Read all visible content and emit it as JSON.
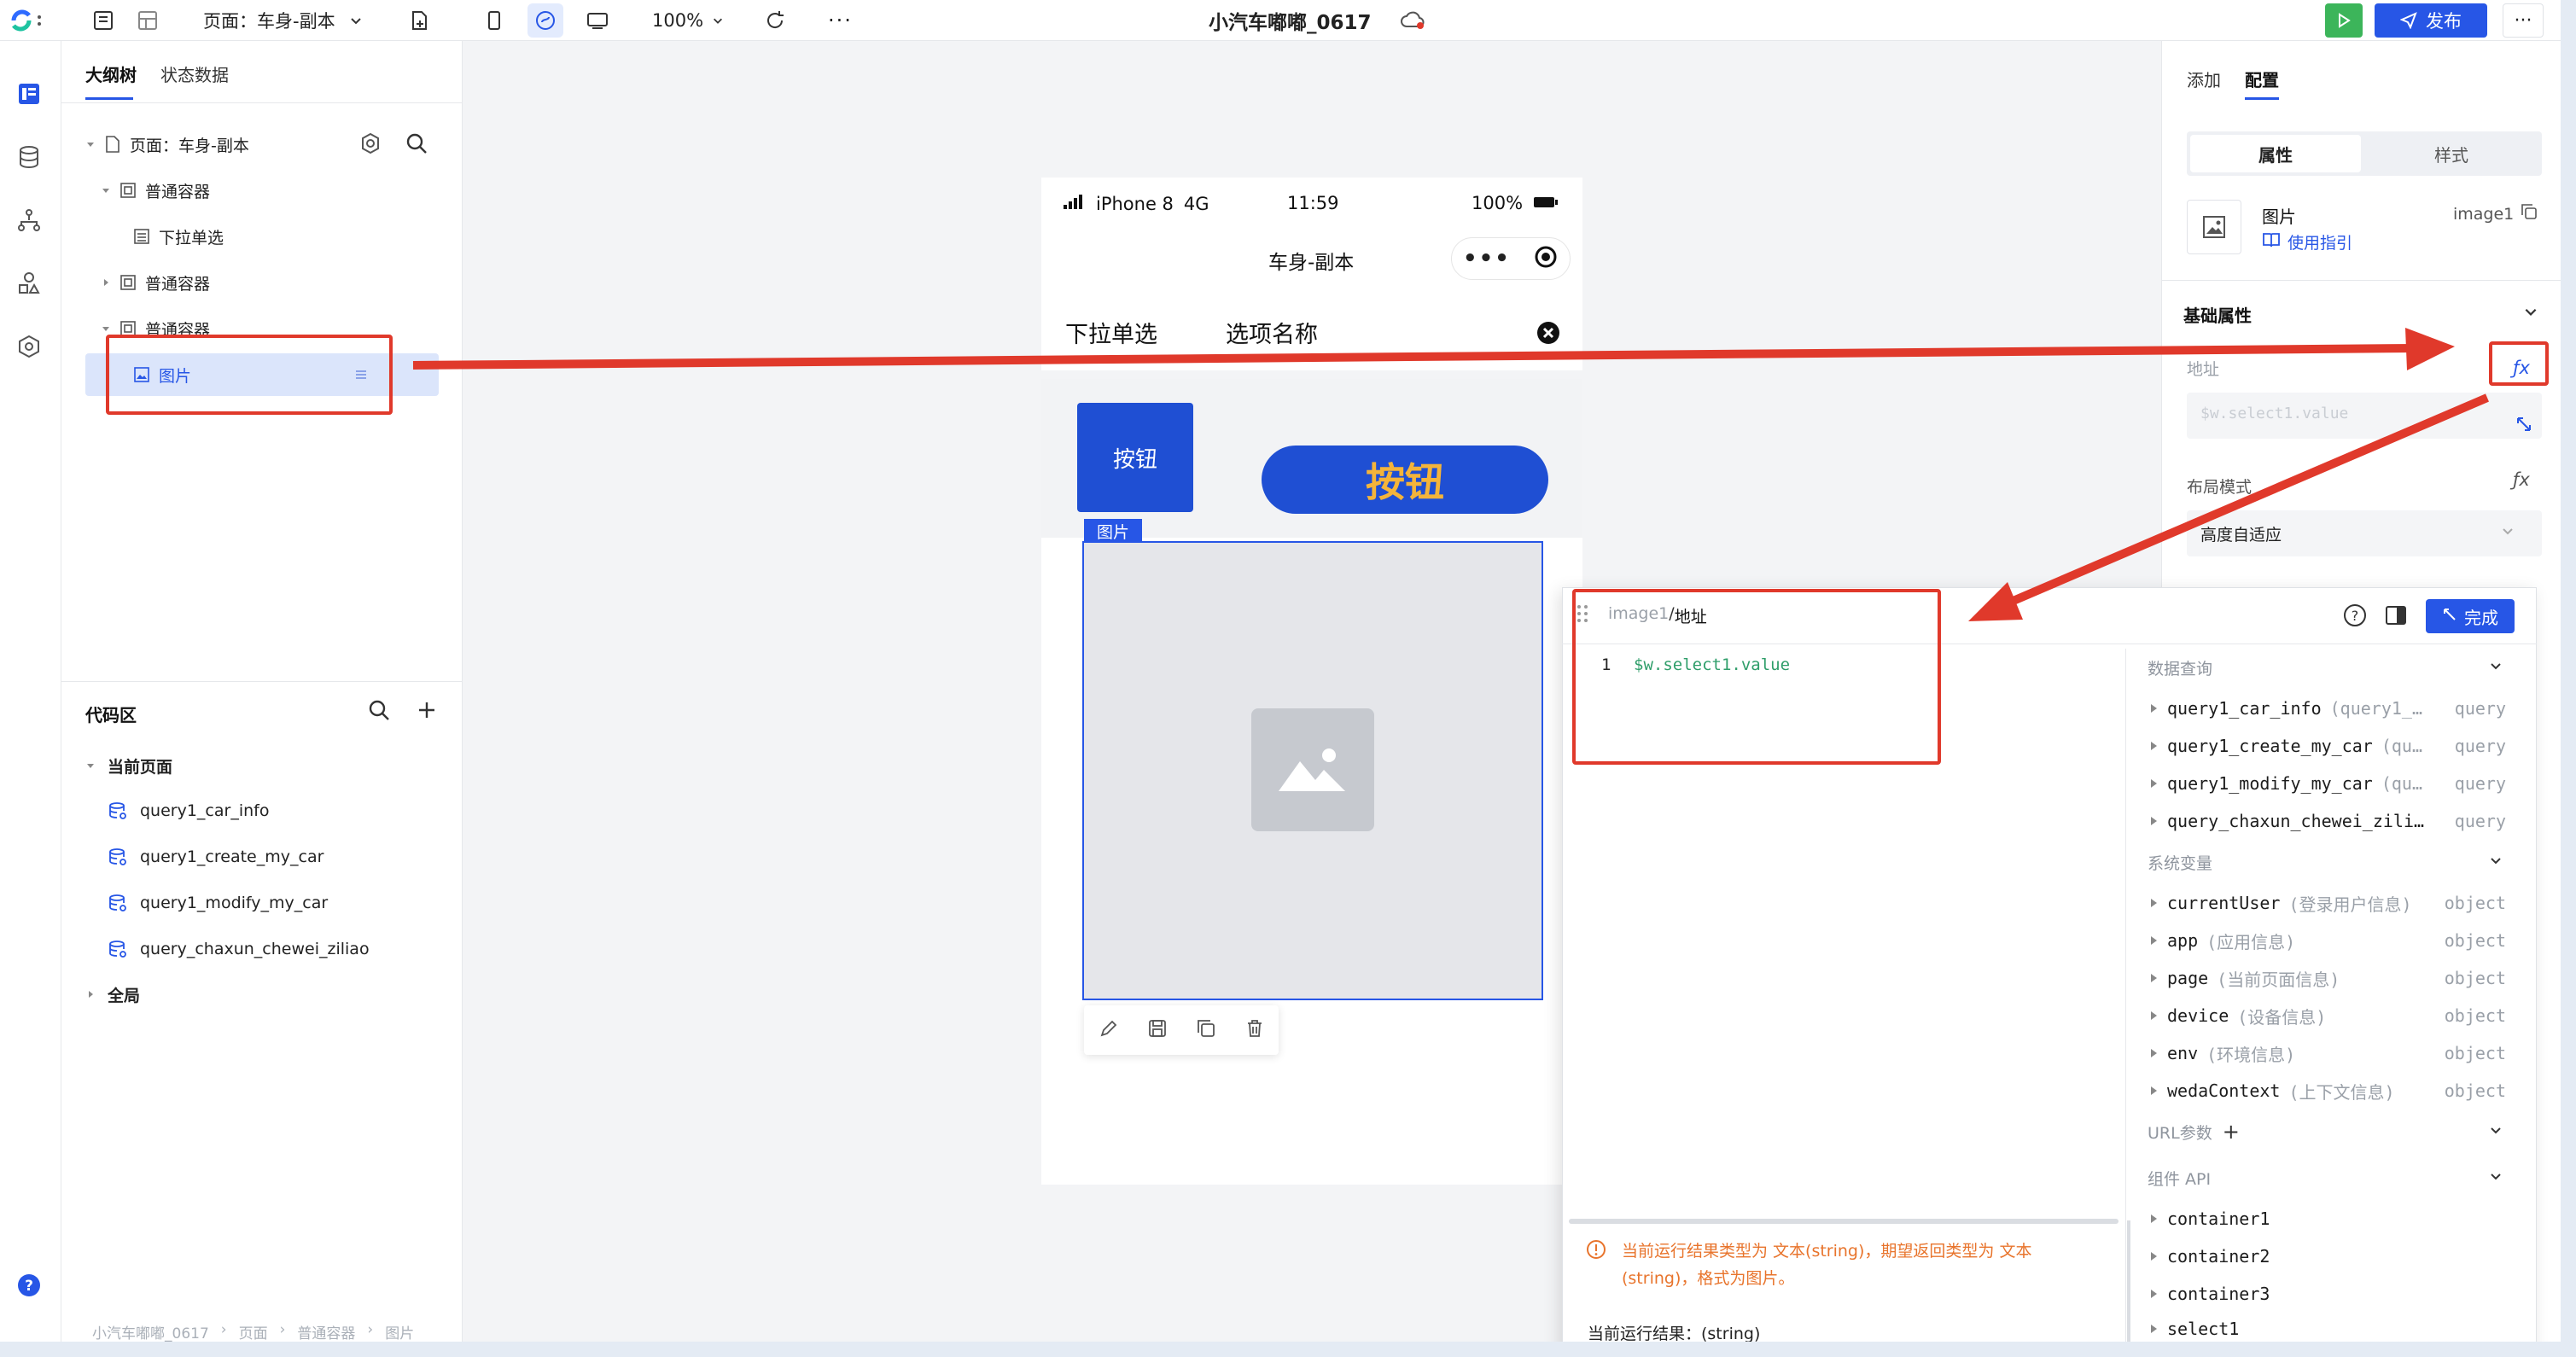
{
  "topbar": {
    "page_selector": "页面：车身-副本",
    "zoom": "100%",
    "app_title": "小汽车嘟嘟_0617",
    "publish_label": "发布"
  },
  "left_panel": {
    "tabs": [
      "大纲树",
      "状态数据"
    ],
    "tree": {
      "root": "页面：车身-副本",
      "container1": "普通容器",
      "dropdown": "下拉单选",
      "container2": "普通容器",
      "container3": "普通容器",
      "image": "图片"
    },
    "code_area": {
      "title": "代码区",
      "current_page": "当前页面",
      "queries": [
        "query1_car_info",
        "query1_create_my_car",
        "query1_modify_my_car",
        "query_chaxun_chewei_ziliao"
      ],
      "global": "全局"
    },
    "footer_breadcrumb": [
      "小汽车嘟嘟_0617",
      "页面",
      "普通容器",
      "图片"
    ]
  },
  "phone": {
    "carrier": "iPhone 8",
    "network": "4G",
    "time": "11:59",
    "battery": "100%",
    "nav_title": "车身-副本",
    "select_label": "下拉单选",
    "select_placeholder": "选项名称",
    "button_small": "按钮",
    "button_large": "按钮",
    "image_tag": "图片"
  },
  "right_panel": {
    "tabs": [
      "添加",
      "配置"
    ],
    "seg_tabs": [
      "属性",
      "样式"
    ],
    "component_name": "图片",
    "component_guide": "使用指引",
    "component_id": "image1",
    "section_basic": "基础属性",
    "address_label": "地址",
    "address_placeholder": "$w.select1.value",
    "layout_label": "布局模式",
    "layout_value": "高度自适应"
  },
  "code_editor": {
    "path_prefix": "image1",
    "path_sep": "/",
    "path_field": "地址",
    "done_label": "完成",
    "line_number": "1",
    "code": "$w.select1.value",
    "warning": "当前运行结果类型为 文本(string)，期望返回类型为 文本(string)，格式为图片。",
    "result_prefix": "当前运行结果：(string)",
    "sections": {
      "data_query": "数据查询",
      "system_vars": "系统变量",
      "url_params": "URL参数",
      "component_api": "组件 API"
    },
    "queries": [
      {
        "name": "query1_car_info",
        "desc": "(query1_…",
        "type": "query"
      },
      {
        "name": "query1_create_my_car",
        "desc": "(qu…",
        "type": "query"
      },
      {
        "name": "query1_modify_my_car",
        "desc": "(qu…",
        "type": "query"
      },
      {
        "name": "query_chaxun_chewei_zili…",
        "desc": "",
        "type": "query"
      }
    ],
    "system_vars": [
      {
        "name": "currentUser",
        "desc": "(登录用户信息)",
        "type": "object"
      },
      {
        "name": "app",
        "desc": "(应用信息)",
        "type": "object"
      },
      {
        "name": "page",
        "desc": "(当前页面信息)",
        "type": "object"
      },
      {
        "name": "device",
        "desc": "(设备信息)",
        "type": "object"
      },
      {
        "name": "env",
        "desc": "(环境信息)",
        "type": "object"
      },
      {
        "name": "wedaContext",
        "desc": "(上下文信息)",
        "type": "object"
      }
    ],
    "components": [
      "container1",
      "container2",
      "container3",
      "select1"
    ]
  },
  "colors": {
    "brand_blue": "#1f4fd3",
    "accent_blue": "#2756e6",
    "publish_green": "#3cb55a",
    "annotation_red": "#e0392b",
    "code_green": "#2f9e6a",
    "warning_orange": "#e8742c"
  }
}
